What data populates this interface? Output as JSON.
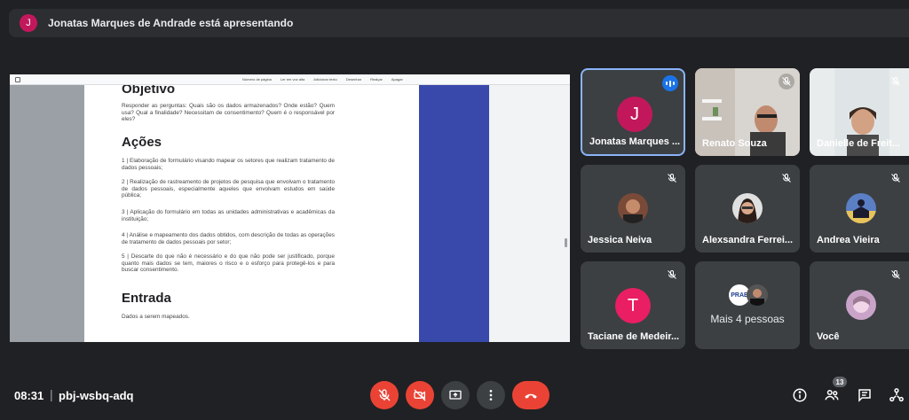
{
  "presenter": {
    "initial": "J",
    "text": "Jonatas Marques de Andrade está apresentando"
  },
  "shared_screen": {
    "toolbar": [
      "Número de página",
      "Ler em voz alta",
      "Adicionar texto",
      "Desenhar",
      "Realçar",
      "Apagar"
    ],
    "sections": [
      {
        "heading": "Objetivo",
        "paragraphs": [
          "Responder as perguntas: Quais são os dados armazenados? Onde estão? Quem usa? Qual a finalidade? Necessitam de consentimento? Quem é o responsável por eles?"
        ]
      },
      {
        "heading": "Ações",
        "paragraphs": [
          "1 | Elaboração de formulário visando mapear os setores que realizam tratamento de dados pessoais;",
          "2 | Realização de rastreamento de projetos de pesquisa que envolvam o tratamento de dados pessoais, especialmente aqueles que envolvam estudos em saúde pública;",
          "3 | Aplicação do formulário em todas as unidades administrativas e acadêmicas da instituição;",
          "4 | Análise e mapeamento dos dados obtidos, com descrição de todas as operações de tratamento de dados pessoais por setor;",
          "5 | Descarte do que não é necessário e do que não pode ser justificado, porque quanto mais dados se tem, maiores o risco e o esforço para protegê-los e para buscar consentimento."
        ]
      },
      {
        "heading": "Entrada",
        "paragraphs": [
          "Dados a serem mapeados."
        ]
      }
    ]
  },
  "participants": [
    {
      "name": "Jonatas Marques ...",
      "initial": "J",
      "color": "#c2185b",
      "speaking": true
    },
    {
      "name": "Renato Souza",
      "muted": true
    },
    {
      "name": "Danielle de Freit...",
      "muted": true
    },
    {
      "name": "Jessica Neiva",
      "muted": true
    },
    {
      "name": "Alexsandra Ferrei...",
      "muted": true
    },
    {
      "name": "Andrea Vieira",
      "muted": true
    },
    {
      "name": "Taciane de Medeir...",
      "initial": "T",
      "color": "#e91e63",
      "muted": true
    },
    {
      "name": "Mais 4 pessoas",
      "badge": "PRAE"
    },
    {
      "name": "Você",
      "muted": true
    }
  ],
  "footer": {
    "time": "08:31",
    "separator": "|",
    "meeting_code": "pbj-wsbq-adq",
    "participant_count": "13"
  },
  "colors": {
    "accent_blue": "#8ab4f8",
    "danger_red": "#ea4335",
    "tile_bg": "#3c4043"
  }
}
